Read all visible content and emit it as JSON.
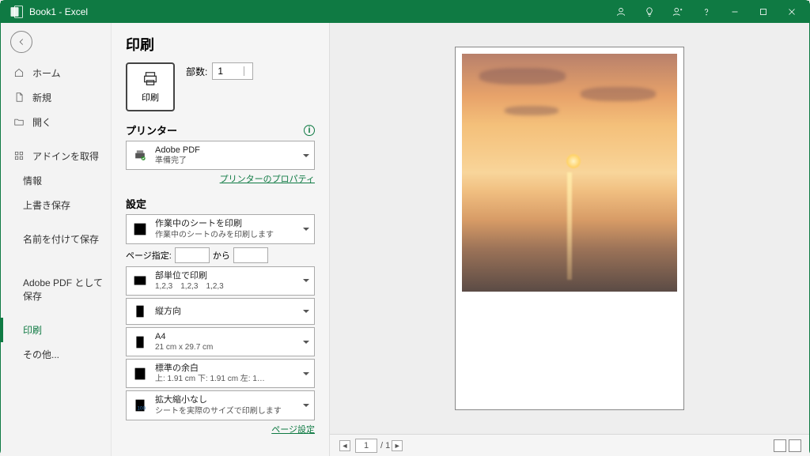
{
  "app": {
    "title": "Book1 - Excel"
  },
  "sidebar": {
    "back": "←",
    "home": "ホーム",
    "new": "新規",
    "open": "開く",
    "get_addins": "アドインを取得",
    "info": "情報",
    "save": "上書き保存",
    "saveas": "名前を付けて保存",
    "adobe_pdf": "Adobe PDF として保存",
    "print": "印刷",
    "other": "その他..."
  },
  "print": {
    "title": "印刷",
    "button_label": "印刷",
    "copies_label": "部数:",
    "copies_value": "1",
    "printer_header": "プリンター",
    "printer_name": "Adobe PDF",
    "printer_status": "準備完了",
    "printer_props_link": "プリンターのプロパティ",
    "settings_header": "設定",
    "scope_l1": "作業中のシートを印刷",
    "scope_l2": "作業中のシートのみを印刷します",
    "pages_label": "ページ指定:",
    "pages_to": "から",
    "collate_l1": "部単位で印刷",
    "collate_l2": "1,2,3　1,2,3　1,2,3",
    "orientation": "縦方向",
    "paper_l1": "A4",
    "paper_l2": "21 cm x 29.7 cm",
    "margins_l1": "標準の余白",
    "margins_l2": "上: 1.91 cm 下: 1.91 cm 左: 1…",
    "scale_l1": "拡大縮小なし",
    "scale_l2": "シートを実際のサイズで印刷します",
    "page_setup_link": "ページ設定"
  },
  "preview": {
    "current_page": "1",
    "total_pages": "1",
    "sep": "/"
  }
}
